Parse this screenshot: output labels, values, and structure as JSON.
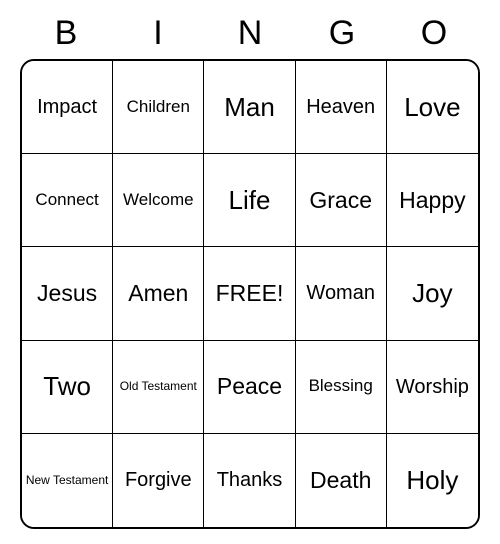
{
  "header": [
    "B",
    "I",
    "N",
    "G",
    "O"
  ],
  "cells": [
    {
      "text": "Impact",
      "size": "s-md"
    },
    {
      "text": "Children",
      "size": "s-sm"
    },
    {
      "text": "Man",
      "size": "s-xl"
    },
    {
      "text": "Heaven",
      "size": "s-md"
    },
    {
      "text": "Love",
      "size": "s-xl"
    },
    {
      "text": "Connect",
      "size": "s-sm"
    },
    {
      "text": "Welcome",
      "size": "s-sm"
    },
    {
      "text": "Life",
      "size": "s-xl"
    },
    {
      "text": "Grace",
      "size": "s-lg"
    },
    {
      "text": "Happy",
      "size": "s-lg"
    },
    {
      "text": "Jesus",
      "size": "s-lg"
    },
    {
      "text": "Amen",
      "size": "s-lg"
    },
    {
      "text": "FREE!",
      "size": "s-lg"
    },
    {
      "text": "Woman",
      "size": "s-md"
    },
    {
      "text": "Joy",
      "size": "s-xl"
    },
    {
      "text": "Two",
      "size": "s-xl"
    },
    {
      "text": "Old Testament",
      "size": "s-xxs"
    },
    {
      "text": "Peace",
      "size": "s-lg"
    },
    {
      "text": "Blessing",
      "size": "s-sm"
    },
    {
      "text": "Worship",
      "size": "s-md"
    },
    {
      "text": "New Testament",
      "size": "s-xxs"
    },
    {
      "text": "Forgive",
      "size": "s-md"
    },
    {
      "text": "Thanks",
      "size": "s-md"
    },
    {
      "text": "Death",
      "size": "s-lg"
    },
    {
      "text": "Holy",
      "size": "s-xl"
    }
  ]
}
